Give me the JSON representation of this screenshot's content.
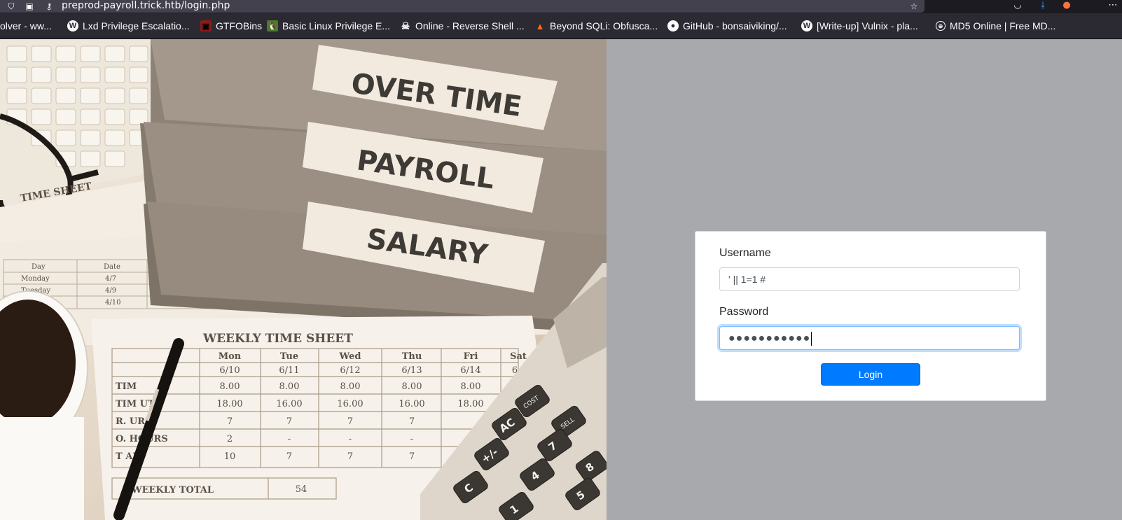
{
  "browser": {
    "url": "preprod-payroll.trick.htb/login.php",
    "bookmarks": [
      {
        "label": "olver - ww...",
        "icon": "none"
      },
      {
        "label": "Lxd Privilege Escalatio...",
        "icon": "wordpress-icon"
      },
      {
        "label": "GTFOBins",
        "icon": "gtfobins-icon"
      },
      {
        "label": "Basic Linux Privilege E...",
        "icon": "tux-icon"
      },
      {
        "label": "Online - Reverse Shell ...",
        "icon": "skull-icon"
      },
      {
        "label": "Beyond SQLi: Obfusca...",
        "icon": "fox-icon"
      },
      {
        "label": "GitHub - bonsaiviking/...",
        "icon": "github-icon"
      },
      {
        "label": "[Write-up] Vulnix - pla...",
        "icon": "wordpress-icon"
      },
      {
        "label": "MD5 Online | Free MD...",
        "icon": "globe-icon"
      }
    ]
  },
  "hero": {
    "binders": [
      "OVER TIME",
      "PAYROLL",
      "SALARY"
    ],
    "sheet_title": "TIME SHEET",
    "weekly_title": "WEEKLY TIME SHEET",
    "days": [
      "Mon",
      "Tue",
      "Wed",
      "Thu",
      "Fri",
      "Sat"
    ],
    "dates": [
      "6/10",
      "6/11",
      "6/12",
      "6/13",
      "6/14",
      "6"
    ],
    "row_in": [
      "8.00",
      "8.00",
      "8.00",
      "8.00",
      "8.00"
    ],
    "row_out": [
      "18.00",
      "16.00",
      "16.00",
      "16.00",
      "18.00"
    ],
    "row_hours": [
      "7",
      "7",
      "7",
      "7"
    ],
    "row_over": [
      "2",
      "-",
      "-",
      "-"
    ],
    "row_total": [
      "10",
      "7",
      "7",
      "7"
    ],
    "weekly_total_label": "WEEKLY TOTAL",
    "weekly_total_value": "54",
    "row_labels": [
      "TIM",
      "TIM  UT",
      "R.   URS",
      "O.   HOURS",
      "T  AL"
    ],
    "calc_keys": [
      "AC",
      "7",
      "8",
      "+/-",
      "4",
      "5",
      "1",
      "C"
    ],
    "calc_labels": [
      "COST",
      "SELL"
    ]
  },
  "login": {
    "username_label": "Username",
    "username_value": "' || 1=1 #",
    "password_label": "Password",
    "password_dots": "●●●●●●●●●●●",
    "login_button": "Login"
  }
}
